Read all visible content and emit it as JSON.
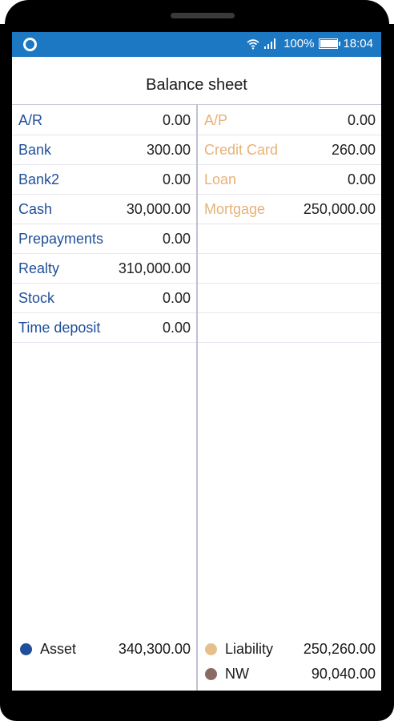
{
  "status": {
    "wifi_icon": "wifi-icon",
    "signal_icon": "signal-icon",
    "battery": "100%",
    "battery_level": 1.0,
    "time": "18:04"
  },
  "title": "Balance sheet",
  "assets": [
    {
      "name": "A/R",
      "value": "0.00"
    },
    {
      "name": "Bank",
      "value": "300.00"
    },
    {
      "name": "Bank2",
      "value": "0.00"
    },
    {
      "name": "Cash",
      "value": "30,000.00"
    },
    {
      "name": "Prepayments",
      "value": "0.00"
    },
    {
      "name": "Realty",
      "value": "310,000.00"
    },
    {
      "name": "Stock",
      "value": "0.00"
    },
    {
      "name": "Time deposit",
      "value": "0.00"
    }
  ],
  "liabilities": [
    {
      "name": "A/P",
      "value": "0.00"
    },
    {
      "name": "Credit Card",
      "value": "260.00"
    },
    {
      "name": "Loan",
      "value": "0.00"
    },
    {
      "name": "Mortgage",
      "value": "250,000.00"
    }
  ],
  "totals": {
    "asset": {
      "label": "Asset",
      "value": "340,300.00",
      "color": "#1f4f9a"
    },
    "liability": {
      "label": "Liability",
      "value": "250,260.00",
      "color": "#e6c08a"
    },
    "nw": {
      "label": "NW",
      "value": "90,040.00",
      "color": "#8a6a62"
    }
  },
  "colors": {
    "statusbar": "#1d78c3",
    "asset_text": "#1f4f9a",
    "liability_text": "#e6b277"
  }
}
